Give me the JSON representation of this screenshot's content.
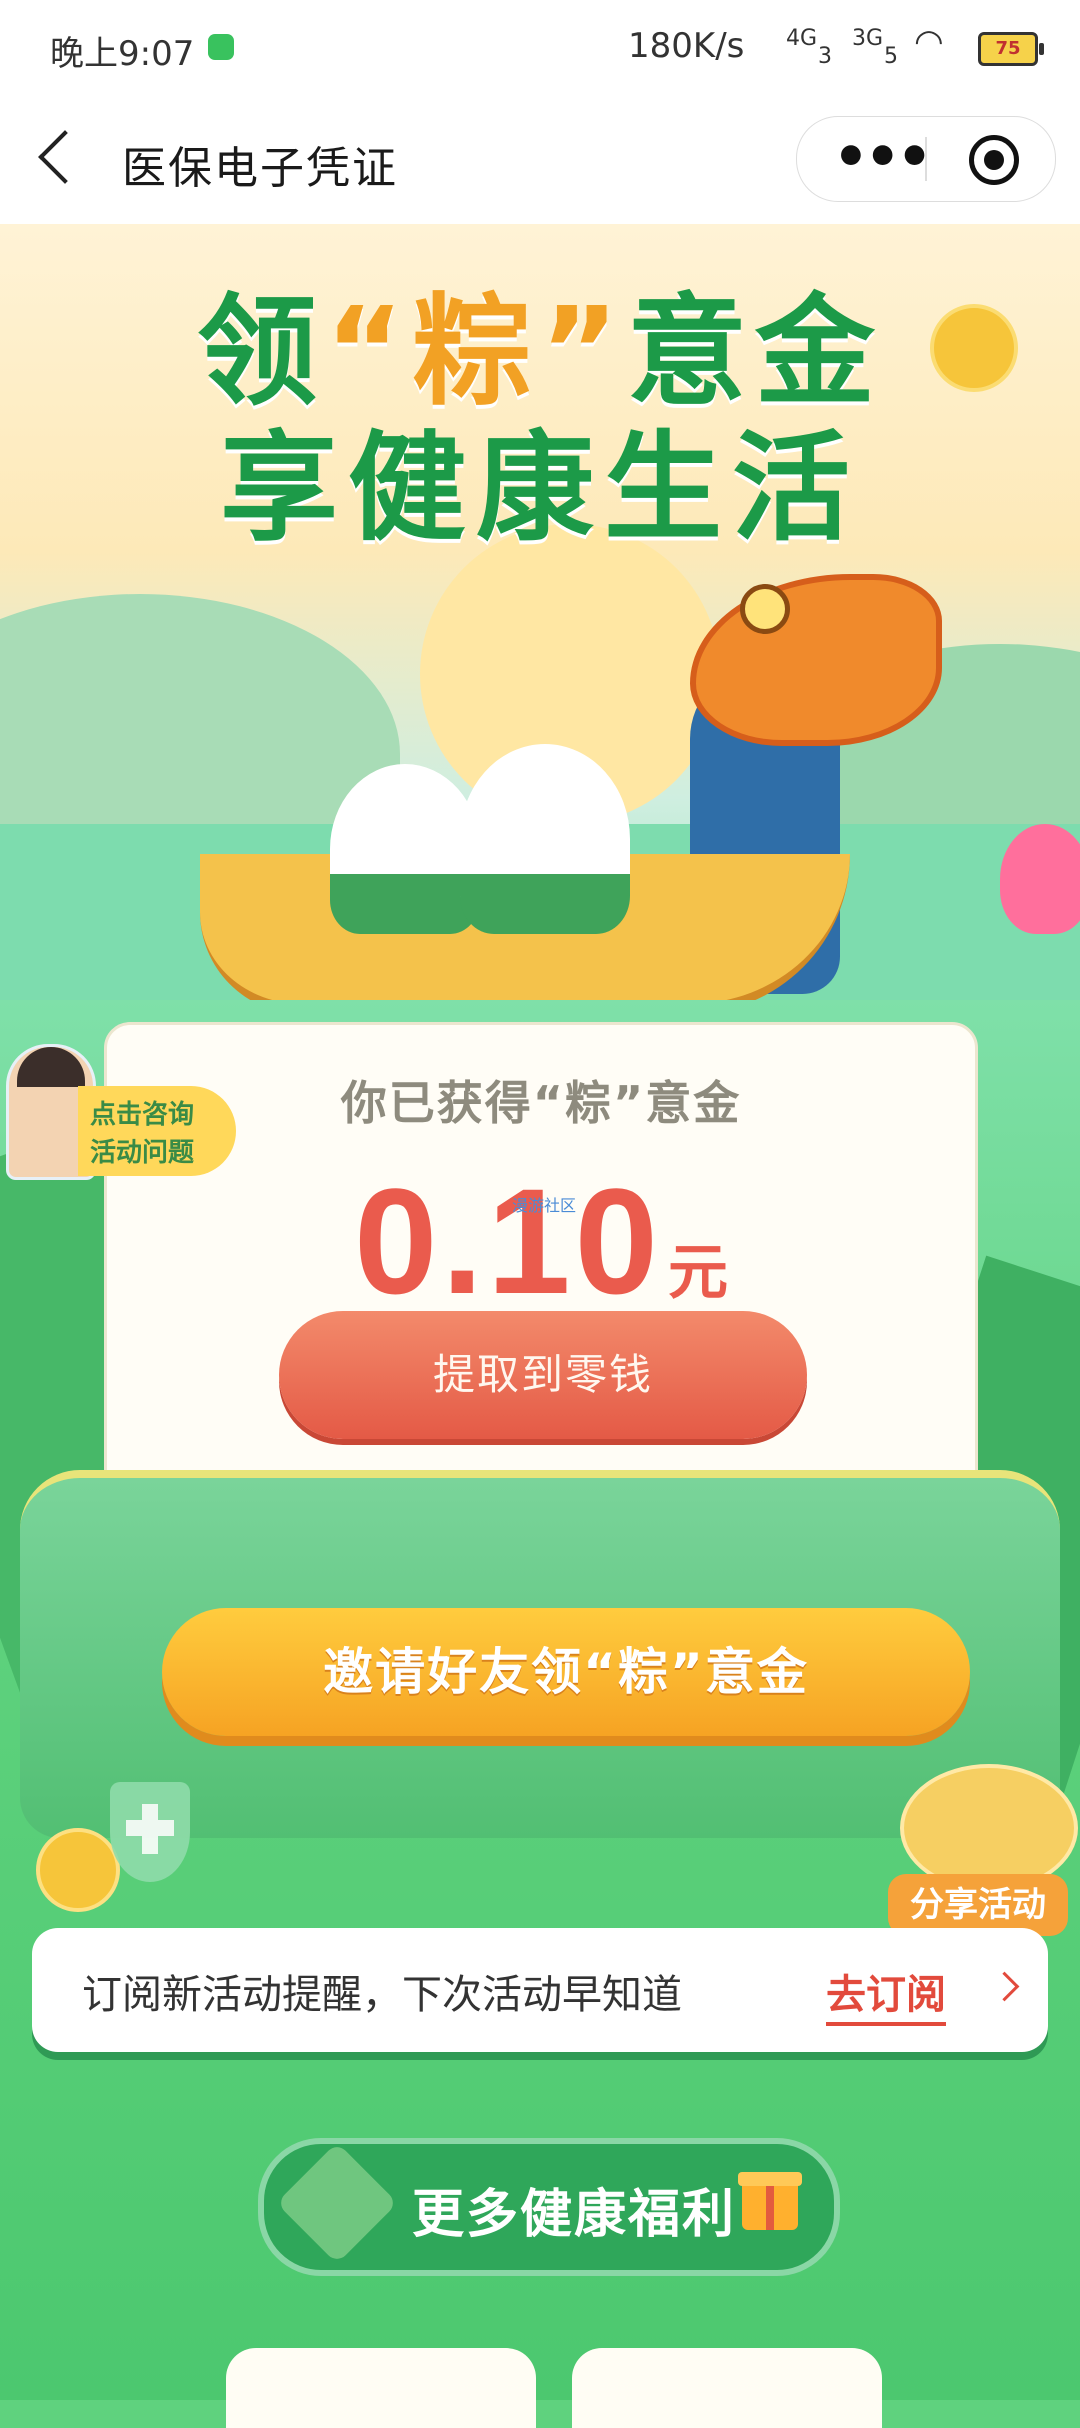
{
  "status_bar": {
    "time": "晚上9:07",
    "network_speed": "180K/s",
    "signal1": "4G",
    "signal1_bars": "3",
    "signal2": "3G",
    "signal2_bars": "5",
    "battery": "75"
  },
  "nav": {
    "title": "医保电子凭证",
    "more_label": "•••"
  },
  "hero": {
    "headline_part1": "领",
    "headline_accent": "“粽”",
    "headline_part2": "意金",
    "headline_line2": "享健康生活"
  },
  "reward_card": {
    "title": "你已获得“粽”意金",
    "amount": "0.10",
    "unit": "元",
    "withdraw_label": "提取到零钱",
    "watermark": "漫游社区"
  },
  "consult": {
    "line1": "点击咨询",
    "line2": "活动问题"
  },
  "invite_label": "邀请好友领“粽”意金",
  "share_label": "分享活动",
  "subscribe": {
    "text": "订阅新活动提醒，下次活动早知道",
    "link": "去订阅"
  },
  "benefits_title": "更多健康福利",
  "colors": {
    "brand_green": "#1c9a48",
    "accent_orange": "#f2a124",
    "amount_red": "#ea5b4d",
    "invite_yellow": "#ffcc3e"
  }
}
